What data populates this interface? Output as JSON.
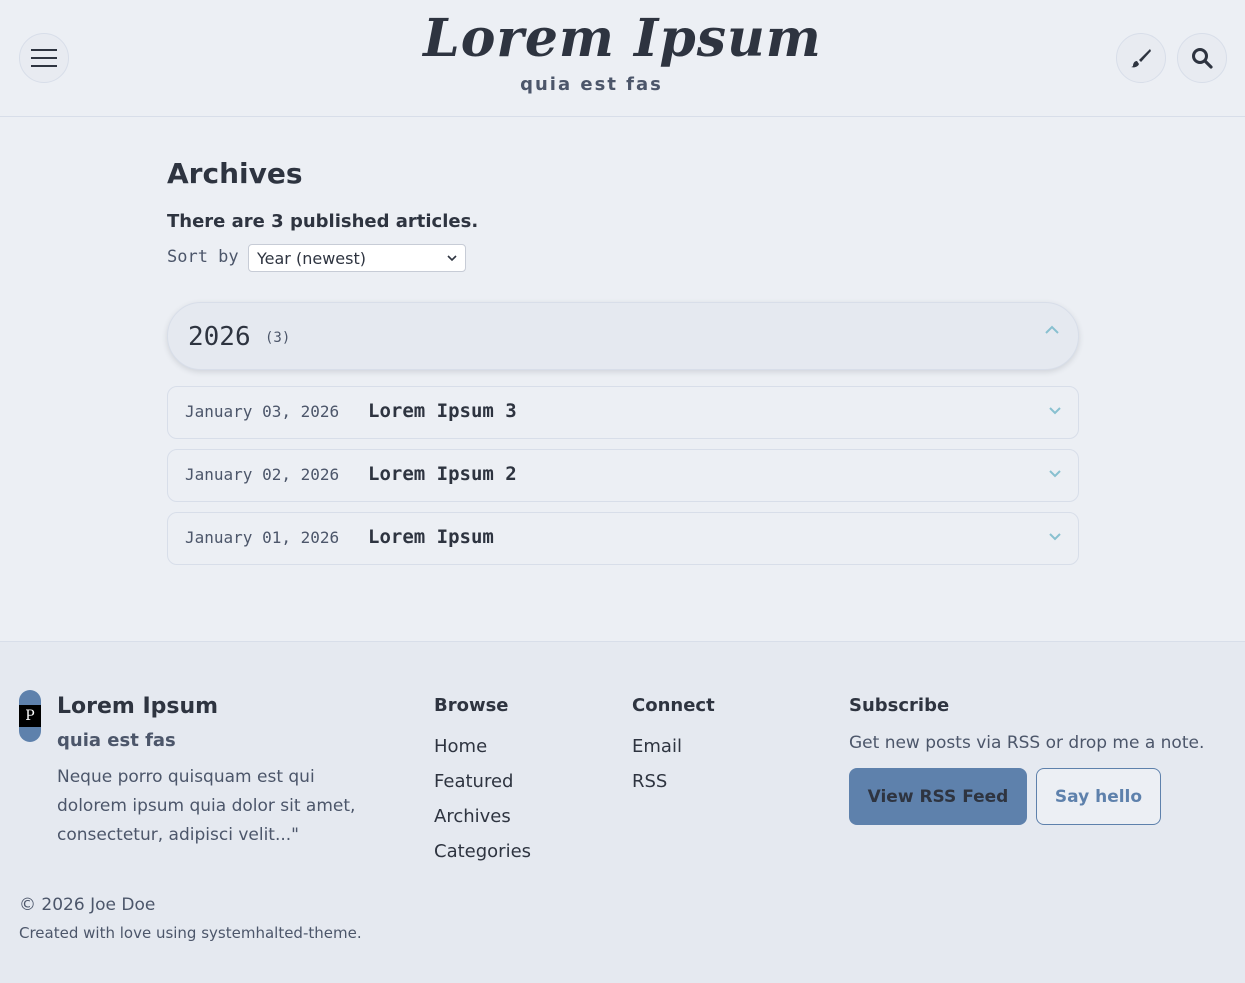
{
  "header": {
    "site_title": "Lorem Ipsum",
    "site_subtitle": "quia est fas",
    "menu_icon": "hamburger-icon",
    "theme_icon": "paintbrush-icon",
    "search_icon": "search-icon"
  },
  "archives": {
    "title": "Archives",
    "count_text": "There are 3 published articles.",
    "sort_label": "Sort by",
    "sort_value": "Year (newest)",
    "year": "2026",
    "year_count": "(3)",
    "posts": [
      {
        "date": "January 03, 2026",
        "title": "Lorem Ipsum 3"
      },
      {
        "date": "January 02, 2026",
        "title": "Lorem Ipsum 2"
      },
      {
        "date": "January 01, 2026",
        "title": "Lorem Ipsum"
      }
    ]
  },
  "footer": {
    "logo_letter": "P",
    "title": "Lorem Ipsum",
    "subtitle": "quia est fas",
    "description": "Neque porro quisquam est qui dolorem ipsum quia dolor sit amet, consectetur, adipisci velit...\"",
    "browse": {
      "heading": "Browse",
      "links": [
        "Home",
        "Featured",
        "Archives",
        "Categories"
      ]
    },
    "connect": {
      "heading": "Connect",
      "links": [
        "Email",
        "RSS"
      ]
    },
    "subscribe": {
      "heading": "Subscribe",
      "text": "Get new posts via RSS or drop me a note.",
      "rss_button": "View RSS Feed",
      "hello_button": "Say hello"
    },
    "copyright": "© 2026 Joe Doe",
    "credit": "Created with love using systemhalted-theme."
  },
  "colors": {
    "background": "#eceff4",
    "text": "#2e3440",
    "accent": "#5e81ac",
    "chevron": "#88c0d0"
  }
}
